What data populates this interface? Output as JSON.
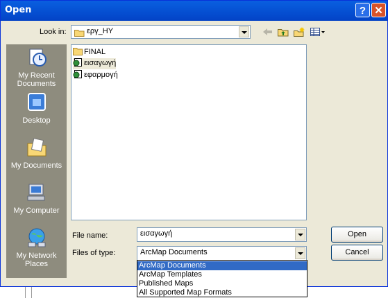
{
  "window": {
    "title": "Open",
    "help_glyph": "?",
    "close_glyph": "✕"
  },
  "toolbar": {
    "look_in_label": "Look in:",
    "look_in_value": "εργ_HY",
    "icons": [
      "back-arrow-icon",
      "up-folder-icon",
      "new-folder-icon",
      "views-menu-icon"
    ]
  },
  "places": [
    {
      "label": "My Recent Documents",
      "icon": "recent-documents-icon"
    },
    {
      "label": "Desktop",
      "icon": "desktop-icon"
    },
    {
      "label": "My Documents",
      "icon": "my-documents-icon"
    },
    {
      "label": "My Computer",
      "icon": "my-computer-icon"
    },
    {
      "label": "My Network Places",
      "icon": "network-places-icon"
    }
  ],
  "files": [
    {
      "name": "FINAL",
      "type": "folder"
    },
    {
      "name": "εισαγωγή",
      "type": "arcmap-document"
    },
    {
      "name": "εφαρμογή",
      "type": "arcmap-document"
    }
  ],
  "form": {
    "file_name_label": "File name:",
    "file_name_value": "εισαγωγή",
    "files_of_type_label": "Files of type:",
    "files_of_type_value": "ArcMap Documents"
  },
  "buttons": {
    "open": "Open",
    "cancel": "Cancel"
  },
  "type_options": [
    "ArcMap Documents",
    "ArcMap Templates",
    "Published Maps",
    "All Supported Map Formats"
  ],
  "colors": {
    "titlebar": "#0654d6",
    "selection": "#316ac5",
    "places_bg": "#8e8c7e",
    "dialog_bg": "#ece9d8"
  }
}
